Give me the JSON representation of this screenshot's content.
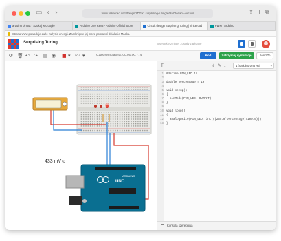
{
  "browser": {
    "url": "www.tinkercad.com/things/2DGY...surprising-turing/editel?tenant=circuits",
    "tabs": [
      {
        "label": "arduino pinout - Szukaj w Google",
        "favicon_color": "#4285f4"
      },
      {
        "label": "Arduino Uno Rev3 - Arduino Official Store",
        "favicon_color": "#00979c"
      },
      {
        "label": "Circuit design Surprising Turing | Tinkercad",
        "favicon_color": "#1f6fd0"
      },
      {
        "label": "PWM | Arduino",
        "favicon_color": "#00979c"
      }
    ],
    "info_message": "Strona www.powoduje duże zużycie energii. Zamknięcie jej może poprawić działanie Macka."
  },
  "header": {
    "project_title": "Surprising Turing",
    "saved_status": "Wszystkie zmiany zostały zapisane"
  },
  "toolbar": {
    "sim_time": "Czas symulatora: 00:00:00.774",
    "code_button": "Kod",
    "sim_button": "Zatrzymaj symulację",
    "send_button": "Send To"
  },
  "circuit": {
    "multimeter_reading": "433 mV"
  },
  "code_panel": {
    "line_number": "1",
    "board": "1 (Arduino Uno R3)",
    "lines": [
      {
        "n": "1",
        "text": "#define PIN_LED 11"
      },
      {
        "n": "2",
        "text": ""
      },
      {
        "n": "3",
        "text": "double percentage = 10;"
      },
      {
        "n": "4",
        "text": ""
      },
      {
        "n": "5",
        "text": "void setup()"
      },
      {
        "n": "6",
        "text": "{"
      },
      {
        "n": "7",
        "text": "  pinMode(PIN_LED, OUTPUT);"
      },
      {
        "n": "8",
        "text": "}"
      },
      {
        "n": "9",
        "text": ""
      },
      {
        "n": "10",
        "text": "void loop()"
      },
      {
        "n": "11",
        "text": "{"
      },
      {
        "n": "12",
        "text": "  analogWrite(PIN_LED, int(((255.0*percentage)/100.0)));"
      },
      {
        "n": "13",
        "text": "}"
      }
    ],
    "serial_monitor": "Konsola szeregowa"
  },
  "colors": {
    "accent_blue": "#1f6fd0",
    "sim_green": "#2ca24a",
    "wire_red": "#d63a2f",
    "wire_blue": "#2a7fd4"
  }
}
